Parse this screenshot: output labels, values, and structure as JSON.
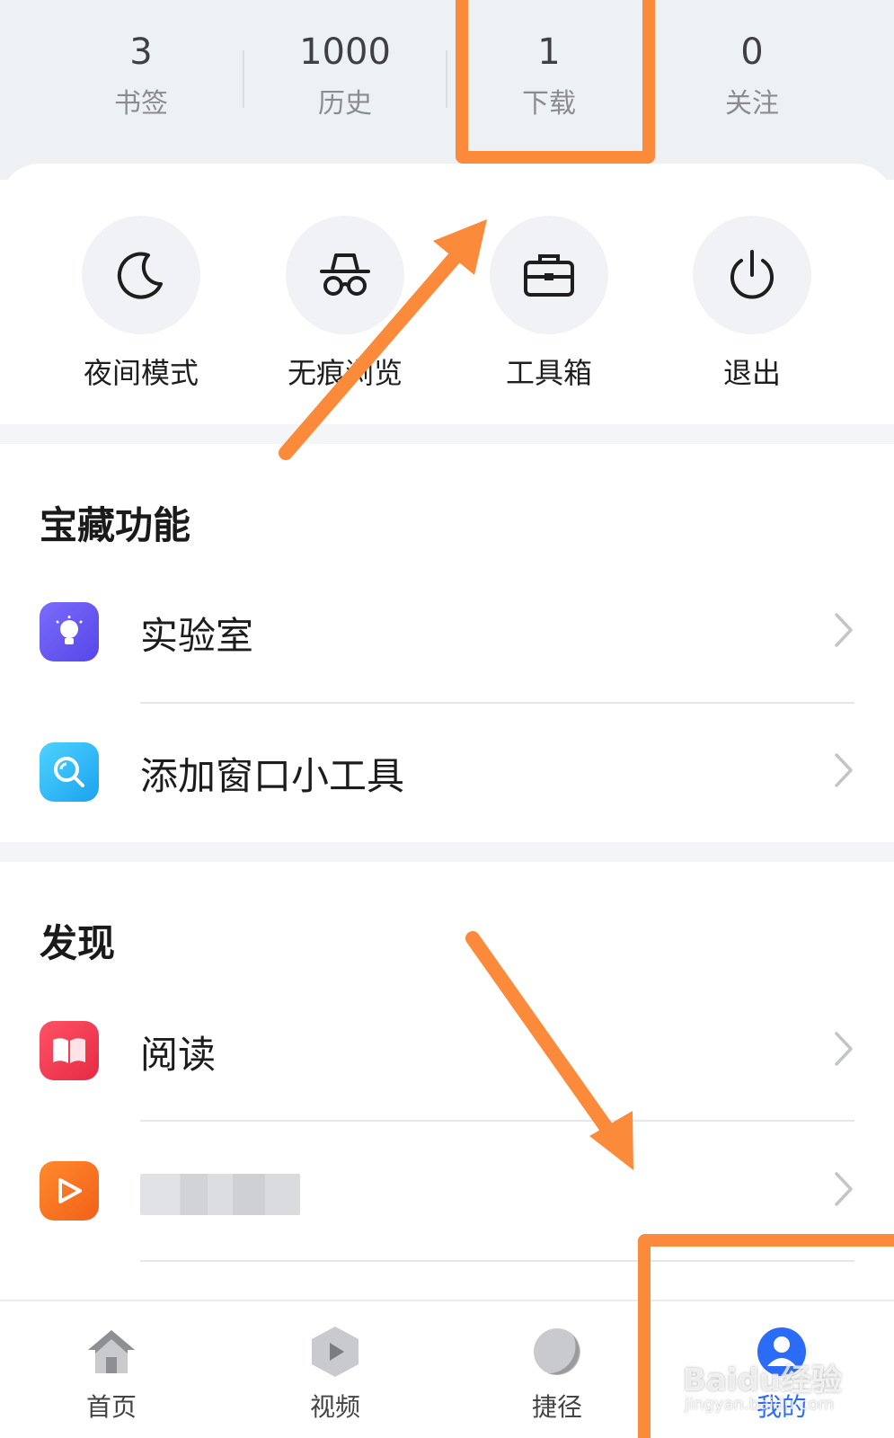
{
  "stats": [
    {
      "value": "3",
      "label": "书签"
    },
    {
      "value": "1000",
      "label": "历史"
    },
    {
      "value": "1",
      "label": "下载"
    },
    {
      "value": "0",
      "label": "关注"
    }
  ],
  "quick_actions": [
    {
      "label": "夜间模式",
      "icon": "moon-icon"
    },
    {
      "label": "无痕浏览",
      "icon": "incognito-icon"
    },
    {
      "label": "工具箱",
      "icon": "toolbox-icon"
    },
    {
      "label": "退出",
      "icon": "power-icon"
    }
  ],
  "treasure": {
    "title": "宝藏功能",
    "items": [
      {
        "label": "实验室",
        "icon": "lightbulb-icon",
        "color": "#6b5cf5"
      },
      {
        "label": "添加窗口小工具",
        "icon": "search-widget-icon",
        "color": "#26b6f2"
      }
    ]
  },
  "discover": {
    "title": "发现",
    "items": [
      {
        "label": "阅读",
        "icon": "book-icon",
        "color": "#f0394f"
      },
      {
        "label": "",
        "icon": "video-play-icon",
        "color": "#f57a1f"
      }
    ]
  },
  "bottom_nav": [
    {
      "label": "首页",
      "icon": "home-icon"
    },
    {
      "label": "视频",
      "icon": "video-icon"
    },
    {
      "label": "捷径",
      "icon": "shortcut-icon"
    },
    {
      "label": "我的",
      "icon": "profile-icon",
      "active": true
    }
  ],
  "watermark": {
    "text": "Baidu经验",
    "sub": "jingyan.baidu.com"
  },
  "colors": {
    "annotation": "#fb8b3a",
    "accent": "#2a6cf5"
  }
}
